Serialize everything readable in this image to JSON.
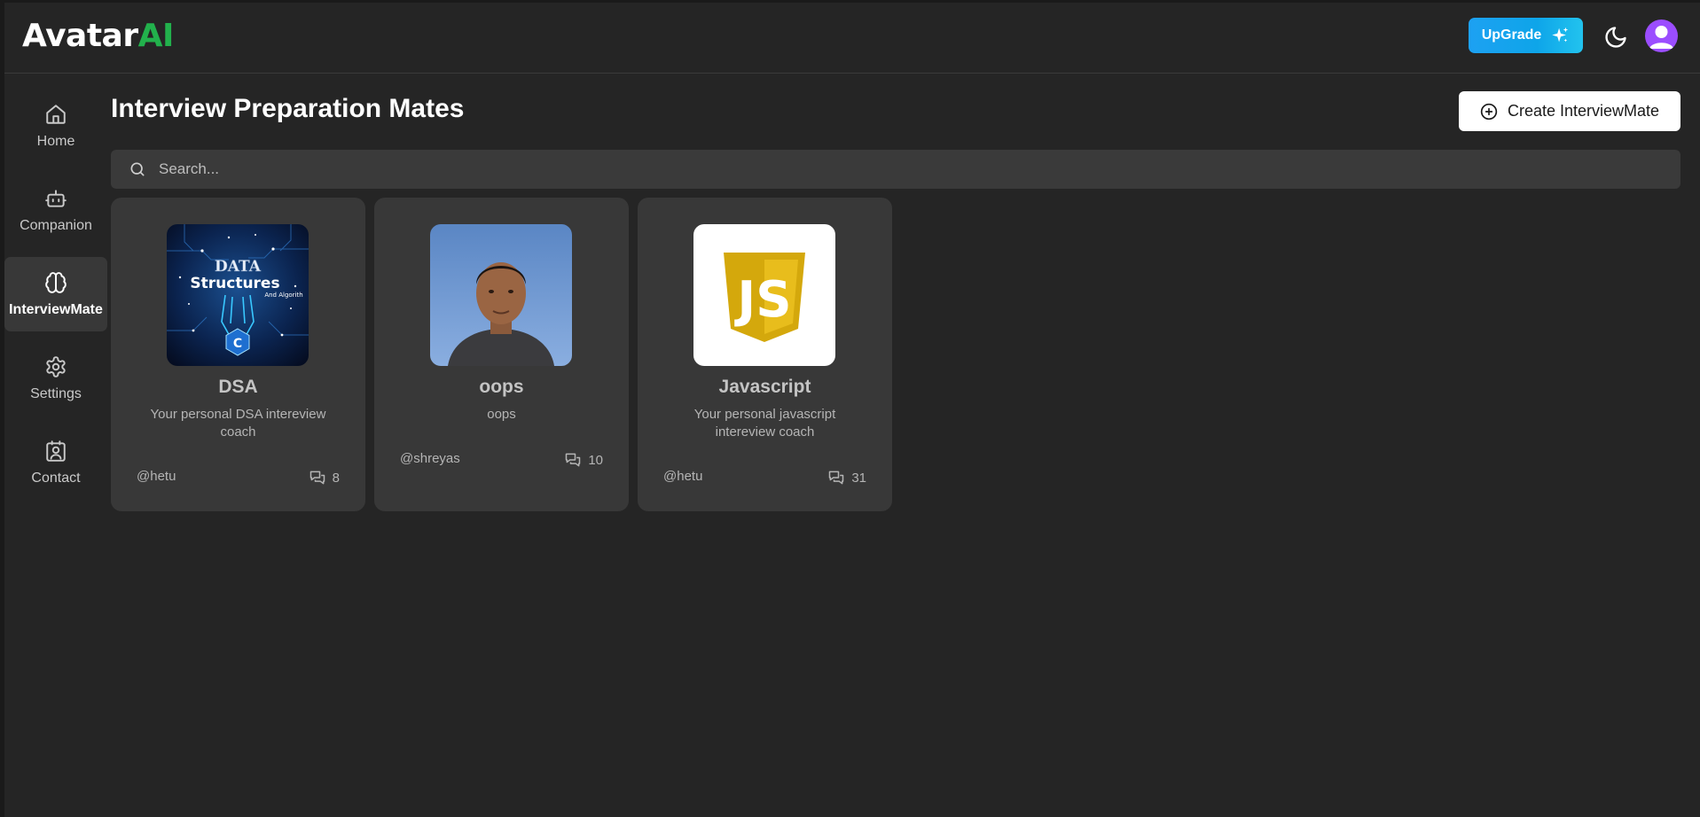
{
  "app": {
    "logo_main": "Avatar",
    "logo_accent": "AI"
  },
  "header": {
    "upgrade_label": "UpGrade"
  },
  "sidebar": {
    "items": [
      {
        "label": "Home",
        "icon": "home-icon"
      },
      {
        "label": "Companion",
        "icon": "bot-icon"
      },
      {
        "label": "InterviewMate",
        "icon": "brain-icon",
        "active": true
      },
      {
        "label": "Settings",
        "icon": "gear-icon"
      },
      {
        "label": "Contact",
        "icon": "contact-icon"
      }
    ]
  },
  "main": {
    "title": "Interview Preparation Mates",
    "create_label": "Create InterviewMate",
    "search_placeholder": "Search..."
  },
  "cards": [
    {
      "name": "DSA",
      "description": "Your personal DSA intereview coach",
      "author": "@hetu",
      "count": "8",
      "thumb_text": [
        "DATA",
        "Structures",
        "And Algorith",
        "C"
      ]
    },
    {
      "name": "oops",
      "description": "oops",
      "author": "@shreyas",
      "count": "10"
    },
    {
      "name": "Javascript",
      "description": "Your personal javascript intereview coach",
      "author": "@hetu",
      "count": "31",
      "thumb_text": [
        "JS"
      ]
    }
  ],
  "colors": {
    "background": "#252525",
    "card": "#383838",
    "accent_green": "#22b14c",
    "upgrade_blue": "#1da1f2",
    "avatar_purple": "#9b4dff",
    "js_yellow": "#d4a80c"
  }
}
